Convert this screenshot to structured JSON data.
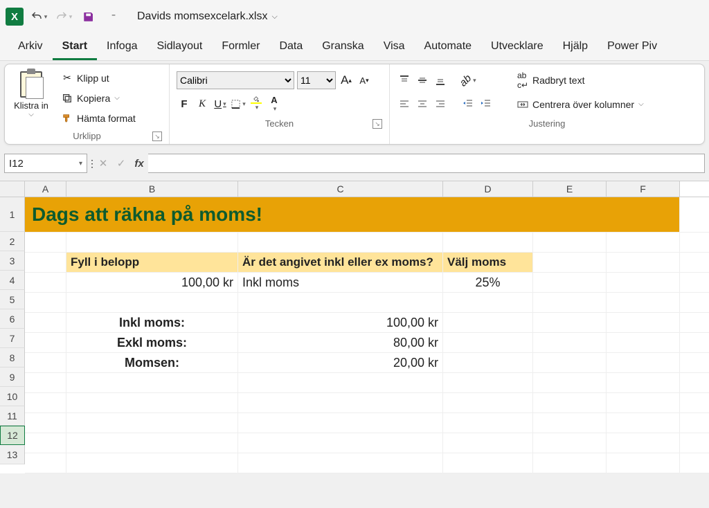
{
  "titlebar": {
    "app_letter": "X",
    "filename": "Davids momsexcelark.xlsx"
  },
  "tabs": [
    "Arkiv",
    "Start",
    "Infoga",
    "Sidlayout",
    "Formler",
    "Data",
    "Granska",
    "Visa",
    "Automate",
    "Utvecklare",
    "Hjälp",
    "Power Piv"
  ],
  "active_tab": "Start",
  "ribbon": {
    "clipboard": {
      "paste": "Klistra in",
      "cut": "Klipp ut",
      "copy": "Kopiera",
      "format_painter": "Hämta format",
      "group": "Urklipp"
    },
    "font": {
      "name": "Calibri",
      "size": "11",
      "increase": "A",
      "decrease": "A",
      "bold": "F",
      "italic": "K",
      "underline": "U",
      "group": "Tecken"
    },
    "alignment": {
      "wrap": "Radbryt text",
      "merge": "Centrera över kolumner",
      "group": "Justering"
    }
  },
  "namebox": "I12",
  "columns": [
    "A",
    "B",
    "C",
    "D",
    "E",
    "F"
  ],
  "rows": [
    "1",
    "2",
    "3",
    "4",
    "5",
    "6",
    "7",
    "8",
    "9",
    "10",
    "11",
    "12",
    "13"
  ],
  "sheet": {
    "title": "Dags att räkna på moms!",
    "hdr_b": "Fyll i belopp",
    "hdr_c": "Är det angivet inkl eller ex moms?",
    "hdr_d": "Välj moms",
    "b4": "100,00 kr",
    "c4": "Inkl moms",
    "d4": "25%",
    "b6": "Inkl moms:",
    "c6": "100,00 kr",
    "b7": "Exkl moms:",
    "c7": "80,00 kr",
    "b8": "Momsen:",
    "c8": "20,00 kr"
  }
}
